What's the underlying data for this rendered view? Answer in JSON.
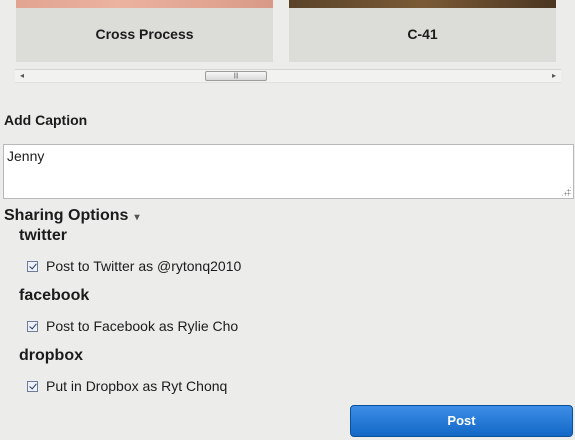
{
  "filters": [
    {
      "label": "Cross Process"
    },
    {
      "label": "C-41"
    }
  ],
  "scrollbar": {
    "left_arrow": "◂",
    "right_arrow": "▸",
    "grip": "|||"
  },
  "caption": {
    "label": "Add Caption",
    "value": "Jenny"
  },
  "sharing": {
    "title": "Sharing Options",
    "caret": "▾",
    "services": [
      {
        "name": "twitter",
        "option": "Post to Twitter as @rytonq2010",
        "checked": true
      },
      {
        "name": "facebook",
        "option": "Post to Facebook as Rylie Cho",
        "checked": true
      },
      {
        "name": "dropbox",
        "option": "Put in Dropbox as Ryt Chonq",
        "checked": true
      }
    ]
  },
  "post_button": {
    "label": "Post"
  },
  "colors": {
    "background": "#ecedeb",
    "card": "#dcdcd8",
    "accent": "#1f74d4"
  }
}
